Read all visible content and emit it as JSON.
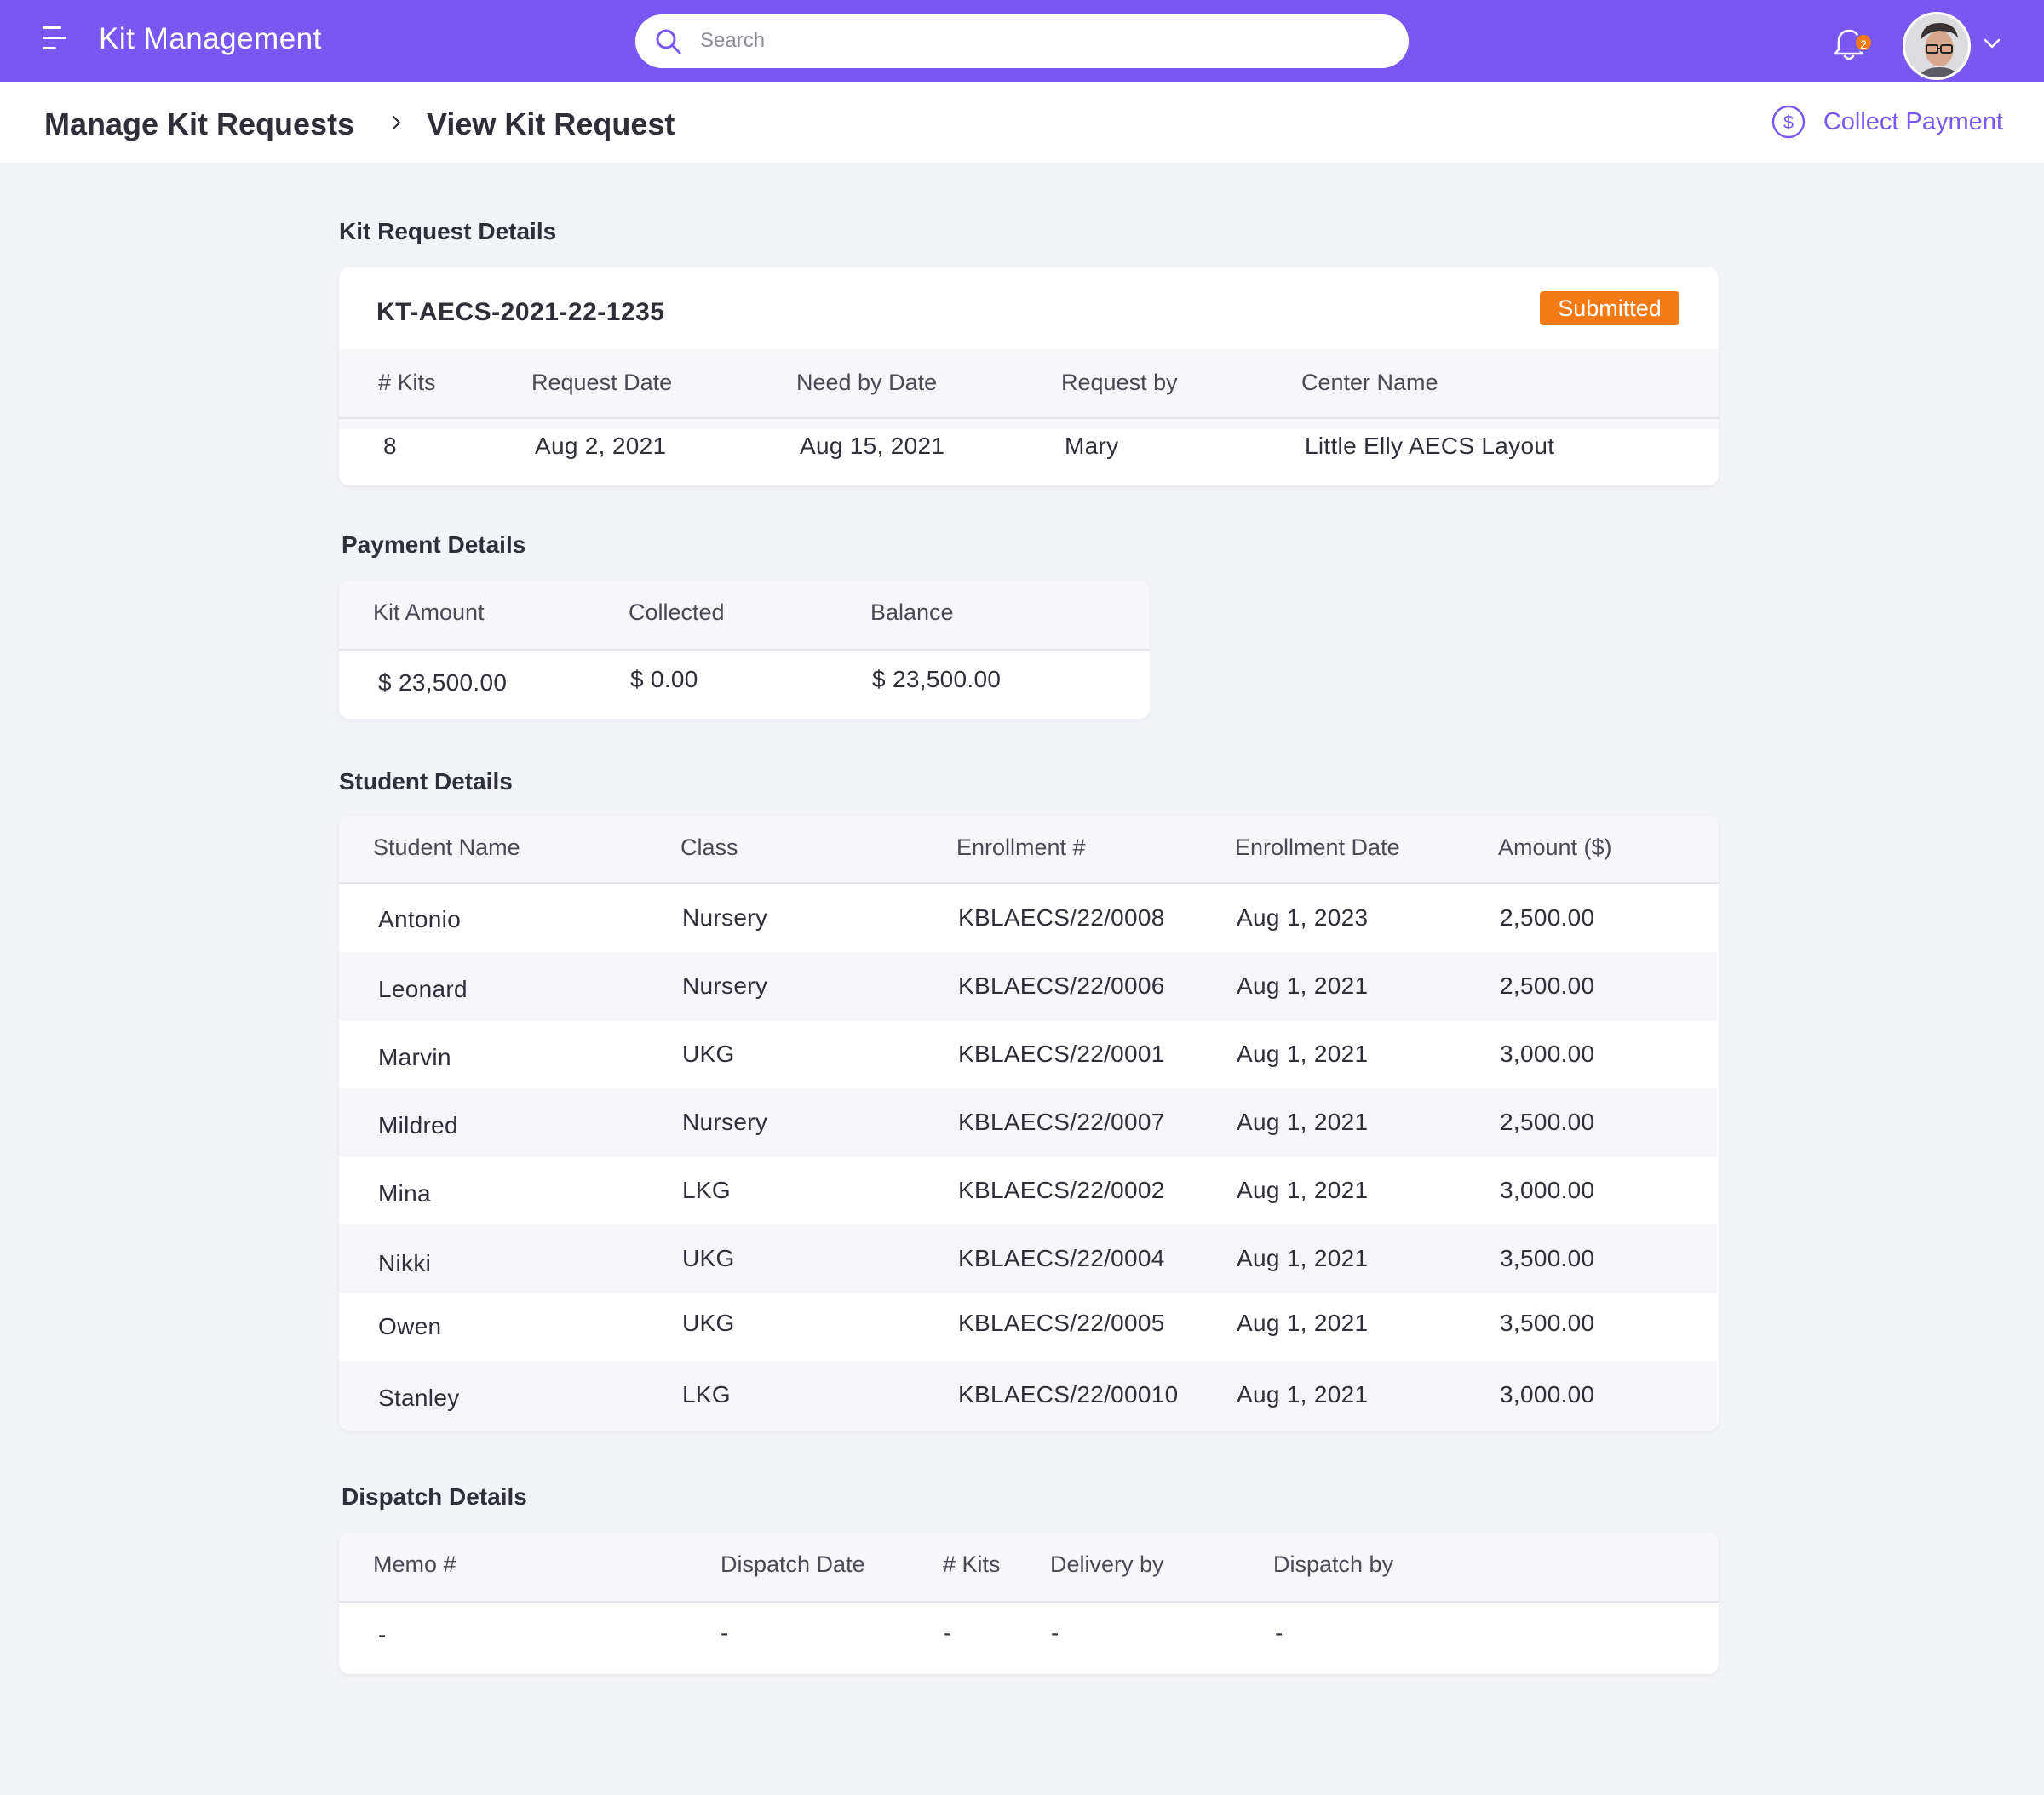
{
  "app": {
    "title": "Kit Management"
  },
  "search": {
    "placeholder": "Search"
  },
  "notifications": {
    "count": "2"
  },
  "breadcrumb": {
    "parent": "Manage Kit Requests",
    "current": "View Kit Request"
  },
  "actions": {
    "collect_payment": "Collect Payment"
  },
  "kit_request": {
    "section_title": "Kit Request Details",
    "id": "KT-AECS-2021-22-1235",
    "status": "Submitted",
    "headers": [
      "# Kits",
      "Request Date",
      "Need by Date",
      "Request by",
      "Center Name"
    ],
    "values": [
      "8",
      "Aug 2, 2021",
      "Aug 15, 2021",
      "Mary",
      "Little Elly AECS Layout"
    ]
  },
  "payment": {
    "section_title": "Payment Details",
    "headers": [
      "Kit Amount",
      "Collected",
      "Balance"
    ],
    "values": [
      "$ 23,500.00",
      "$ 0.00",
      "$ 23,500.00"
    ]
  },
  "students": {
    "section_title": "Student Details",
    "headers": [
      "Student Name",
      "Class",
      "Enrollment #",
      "Enrollment Date",
      "Amount ($)"
    ],
    "rows": [
      [
        "Antonio",
        "Nursery",
        "KBLAECS/22/0008",
        "Aug 1, 2023",
        "2,500.00"
      ],
      [
        "Leonard",
        "Nursery",
        "KBLAECS/22/0006",
        "Aug 1, 2021",
        "2,500.00"
      ],
      [
        "Marvin",
        "UKG",
        "KBLAECS/22/0001",
        "Aug 1, 2021",
        "3,000.00"
      ],
      [
        "Mildred",
        "Nursery",
        "KBLAECS/22/0007",
        "Aug 1, 2021",
        "2,500.00"
      ],
      [
        "Mina",
        "LKG",
        "KBLAECS/22/0002",
        "Aug 1, 2021",
        "3,000.00"
      ],
      [
        "Nikki",
        "UKG",
        "KBLAECS/22/0004",
        "Aug 1, 2021",
        "3,500.00"
      ],
      [
        "Owen",
        "UKG",
        "KBLAECS/22/0005",
        "Aug 1, 2021",
        "3,500.00"
      ],
      [
        "Stanley",
        "LKG",
        "KBLAECS/22/00010",
        "Aug 1, 2021",
        "3,000.00"
      ]
    ]
  },
  "dispatch": {
    "section_title": "Dispatch Details",
    "headers": [
      "Memo #",
      "Dispatch Date",
      "# Kits",
      "Delivery by",
      "Dispatch by"
    ],
    "values": [
      "-",
      "-",
      "-",
      "-",
      "-"
    ]
  },
  "colors": {
    "brand": "#7858f0",
    "status_submitted": "#f47a16",
    "background": "#f3f4f8"
  },
  "icons": [
    "menu-icon",
    "search-icon",
    "bell-icon",
    "chevron-down-icon",
    "chevron-right-icon",
    "dollar-circle-icon"
  ]
}
